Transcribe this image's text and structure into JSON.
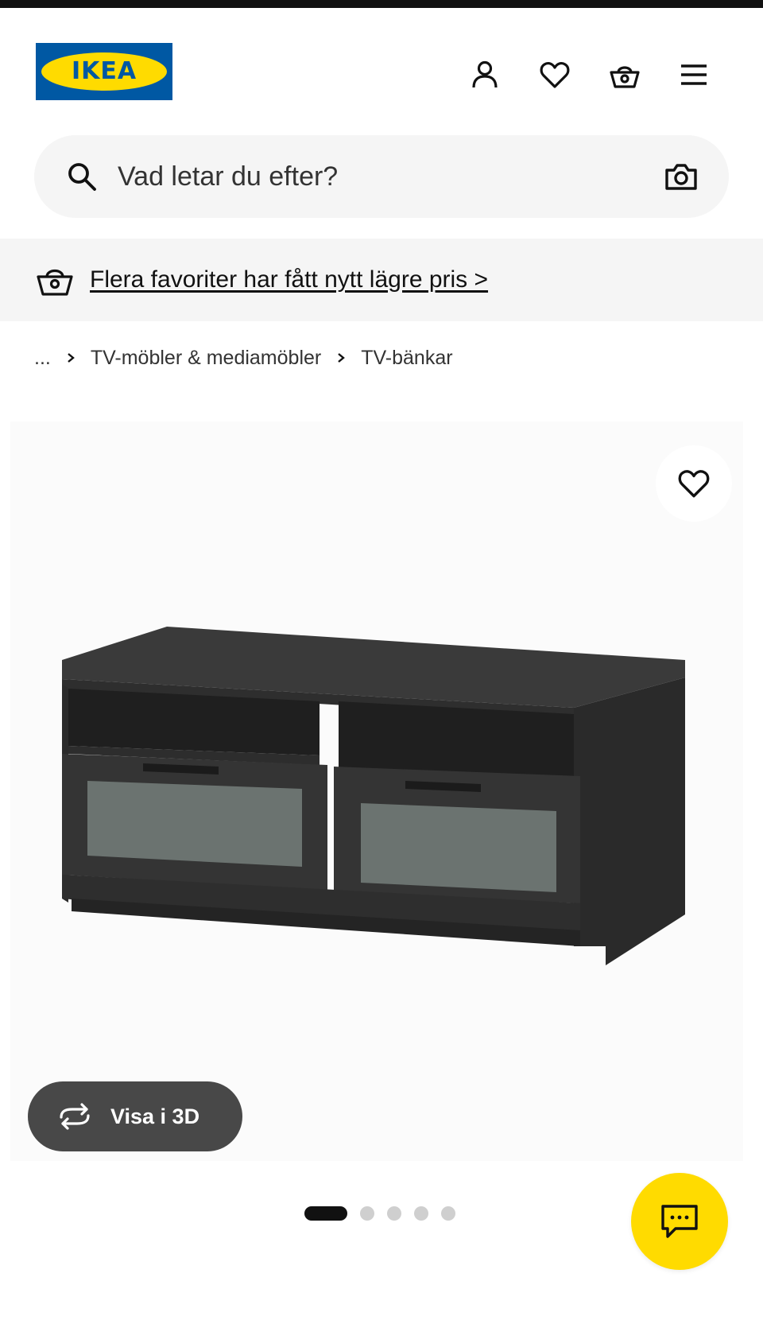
{
  "brand": {
    "logo_text": "IKEA",
    "colors": {
      "blue": "#0058a3",
      "yellow": "#ffdb00",
      "dark_button": "#484848"
    }
  },
  "header": {
    "icons": [
      "user-icon",
      "heart-icon",
      "basket-icon",
      "hamburger-menu-icon"
    ]
  },
  "search": {
    "placeholder": "Vad letar du efter?",
    "search_icon": "search-icon",
    "camera_icon": "camera-icon"
  },
  "promo": {
    "icon": "basket-icon",
    "link_text": "Flera favoriter har fått nytt lägre pris >"
  },
  "breadcrumb": {
    "ellipsis": "...",
    "items": [
      "TV-möbler & mediamöbler",
      "TV-bänkar"
    ]
  },
  "gallery": {
    "favorite_icon": "heart-icon",
    "view_3d_label": "Visa i 3D",
    "view_3d_icon": "rotate-3d-icon",
    "image_count": 5,
    "active_index": 0
  },
  "chat": {
    "icon": "chat-bubble-icon"
  }
}
